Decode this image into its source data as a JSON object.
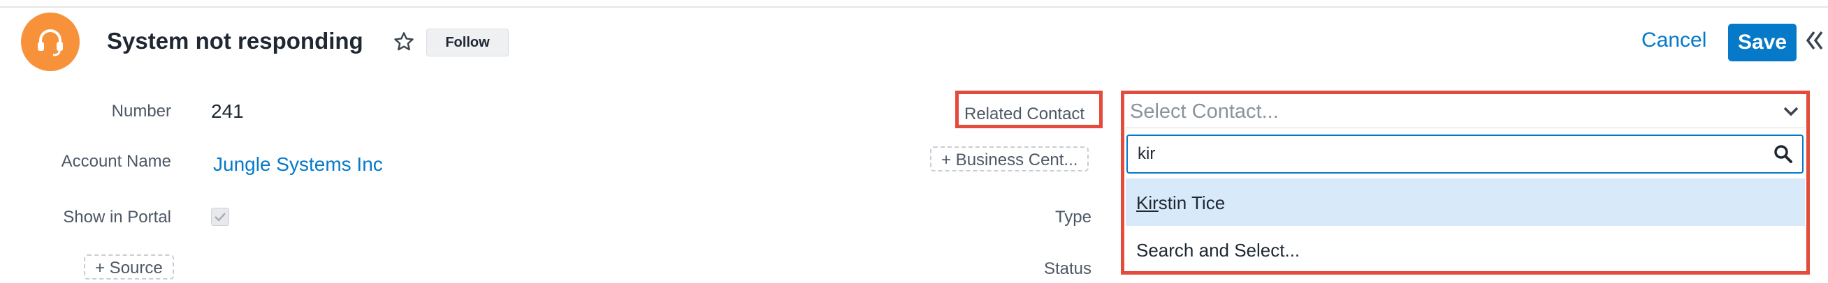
{
  "record": {
    "title": "System not responding",
    "follow_label": "Follow"
  },
  "actions": {
    "cancel_label": "Cancel",
    "save_label": "Save"
  },
  "fields": {
    "number_label": "Number",
    "number_value": "241",
    "account_label": "Account Name",
    "account_value": "Jungle Systems Inc",
    "portal_label": "Show in Portal",
    "source_button": "+ Source",
    "related_contact_label": "Related Contact",
    "business_center_button": "+ Business Cent...",
    "type_label": "Type",
    "status_label": "Status"
  },
  "contact_select": {
    "placeholder": "Select Contact...",
    "search_value": "kir",
    "options": [
      {
        "match": "Kir",
        "rest": "stin Tice"
      },
      {
        "label": "Search and Select..."
      }
    ]
  },
  "colors": {
    "accent": "#0679c8",
    "avatar": "#f7923a",
    "highlight_border": "#e34b3c",
    "option_highlight": "#d8eaf9"
  },
  "icons": [
    "headset-icon",
    "star-icon",
    "collapse-icon",
    "chevron-down-icon",
    "search-icon"
  ]
}
